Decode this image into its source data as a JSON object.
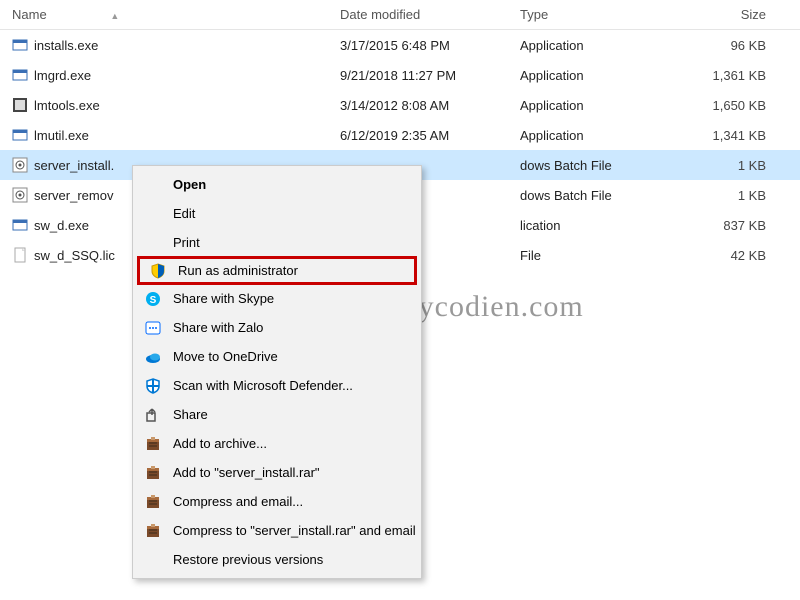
{
  "columns": {
    "name": "Name",
    "date": "Date modified",
    "type": "Type",
    "size": "Size"
  },
  "files": [
    {
      "icon": "exe1",
      "name": "installs.exe",
      "date": "3/17/2015 6:48 PM",
      "type": "Application",
      "size": "96 KB"
    },
    {
      "icon": "exe1",
      "name": "lmgrd.exe",
      "date": "9/21/2018 11:27 PM",
      "type": "Application",
      "size": "1,361 KB"
    },
    {
      "icon": "exe2",
      "name": "lmtools.exe",
      "date": "3/14/2012 8:08 AM",
      "type": "Application",
      "size": "1,650 KB"
    },
    {
      "icon": "exe1",
      "name": "lmutil.exe",
      "date": "6/12/2019 2:35 AM",
      "type": "Application",
      "size": "1,341 KB"
    },
    {
      "icon": "bat",
      "name": "server_install.",
      "date": "",
      "type": "dows Batch File",
      "size": "1 KB",
      "selected": true
    },
    {
      "icon": "bat",
      "name": "server_remov",
      "date": "",
      "type": "dows Batch File",
      "size": "1 KB"
    },
    {
      "icon": "exe1",
      "name": "sw_d.exe",
      "date": "",
      "type": "lication",
      "size": "837 KB"
    },
    {
      "icon": "doc",
      "name": "sw_d_SSQ.lic",
      "date": "",
      "type": "File",
      "size": "42 KB"
    }
  ],
  "context_menu": [
    {
      "icon": "",
      "label": "Open",
      "bold": true
    },
    {
      "icon": "",
      "label": "Edit"
    },
    {
      "icon": "",
      "label": "Print"
    },
    {
      "icon": "shield",
      "label": "Run as administrator",
      "highlight": true
    },
    {
      "icon": "skype",
      "label": "Share with Skype"
    },
    {
      "icon": "zalo",
      "label": "Share with Zalo"
    },
    {
      "icon": "onedrive",
      "label": "Move to OneDrive"
    },
    {
      "icon": "defender",
      "label": "Scan with Microsoft Defender..."
    },
    {
      "icon": "share",
      "label": "Share"
    },
    {
      "icon": "winrar",
      "label": "Add to archive..."
    },
    {
      "icon": "winrar",
      "label": "Add to \"server_install.rar\""
    },
    {
      "icon": "winrar",
      "label": "Compress and email..."
    },
    {
      "icon": "winrar",
      "label": "Compress to \"server_install.rar\" and email"
    },
    {
      "icon": "",
      "label": "Restore previous versions"
    }
  ],
  "watermark": "maycodien.com"
}
